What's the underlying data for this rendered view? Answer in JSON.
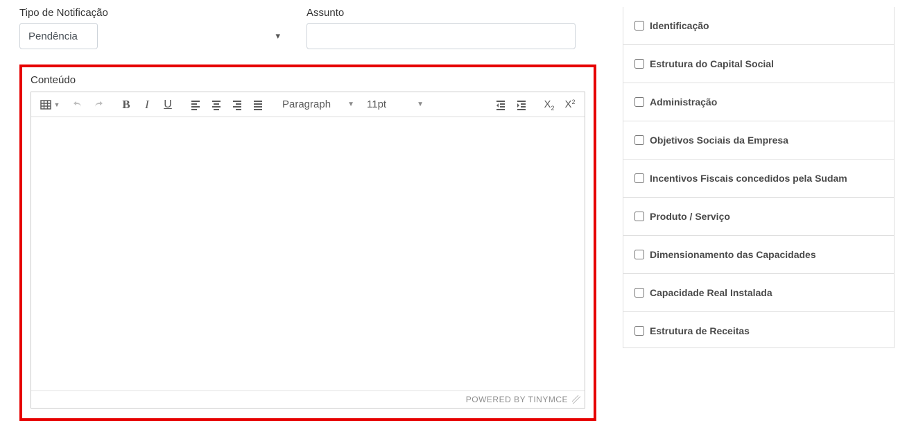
{
  "form": {
    "tipo_label": "Tipo de Notificação",
    "tipo_value": "Pendência",
    "assunto_label": "Assunto",
    "assunto_value": ""
  },
  "content": {
    "label": "Conteúdo"
  },
  "editor": {
    "format_label": "Paragraph",
    "fontsize_label": "11pt",
    "footer": "POWERED BY TINYMCE"
  },
  "checklist": {
    "items": [
      {
        "label": "Identificação"
      },
      {
        "label": "Estrutura do Capital Social"
      },
      {
        "label": "Administração"
      },
      {
        "label": "Objetivos Sociais da Empresa"
      },
      {
        "label": "Incentivos Fiscais concedidos pela Sudam"
      },
      {
        "label": "Produto / Serviço"
      },
      {
        "label": "Dimensionamento das Capacidades"
      },
      {
        "label": "Capacidade Real Instalada"
      },
      {
        "label": "Estrutura de Receitas"
      }
    ]
  }
}
